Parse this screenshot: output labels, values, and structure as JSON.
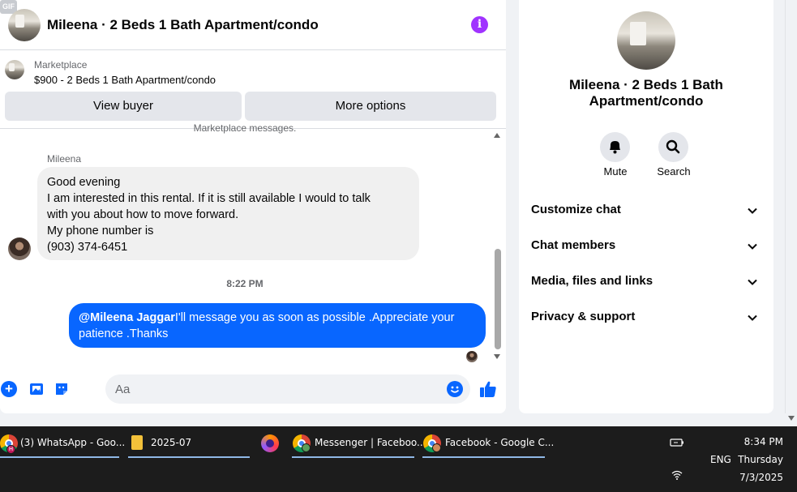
{
  "chat": {
    "title": "Mileena · 2 Beds 1 Bath Apartment/condo",
    "marketplace_label": "Marketplace",
    "listing": "$900 - 2 Beds 1 Bath Apartment/condo",
    "view_buyer_label": "View buyer",
    "more_options_label": "More options",
    "partial_notice": "Marketplace messages.",
    "sender_name": "Mileena",
    "incoming_lines": [
      "Good evening",
      "I am interested in this rental. If it is still available I would to talk",
      "with you about how to move forward.",
      "My phone number is",
      "(903) 374-6451"
    ],
    "timestamp": "8:22 PM",
    "outgoing_mention": "@Mileena Jaggar",
    "outgoing_text": "I'll message you as soon as possible .Appreciate your patience .Thanks",
    "composer_placeholder": "Aa",
    "gif_label": "GIF"
  },
  "details": {
    "title": "Mileena · 2 Beds 1 Bath Apartment/condo",
    "mute_label": "Mute",
    "search_label": "Search",
    "sections": [
      "Customize chat",
      "Chat members",
      "Media, files and links",
      "Privacy & support"
    ]
  },
  "taskbar": {
    "items": [
      {
        "label": "(3) WhatsApp - Goo...",
        "icon": "chrome-icon",
        "badge": "H"
      },
      {
        "label": "2025-07",
        "icon": "folder-icon"
      },
      {
        "label": "",
        "icon": "firefox-icon"
      },
      {
        "label": "Messenger | Faceboo...",
        "icon": "chrome-icon"
      },
      {
        "label": "Facebook - Google C...",
        "icon": "chrome-icon"
      }
    ],
    "language": "ENG",
    "time": "8:34 PM",
    "day": "Thursday",
    "date": "7/3/2025"
  },
  "colors": {
    "accent": "#0866ff",
    "info": "#a033ff",
    "taskbar": "#1c1c1c"
  }
}
